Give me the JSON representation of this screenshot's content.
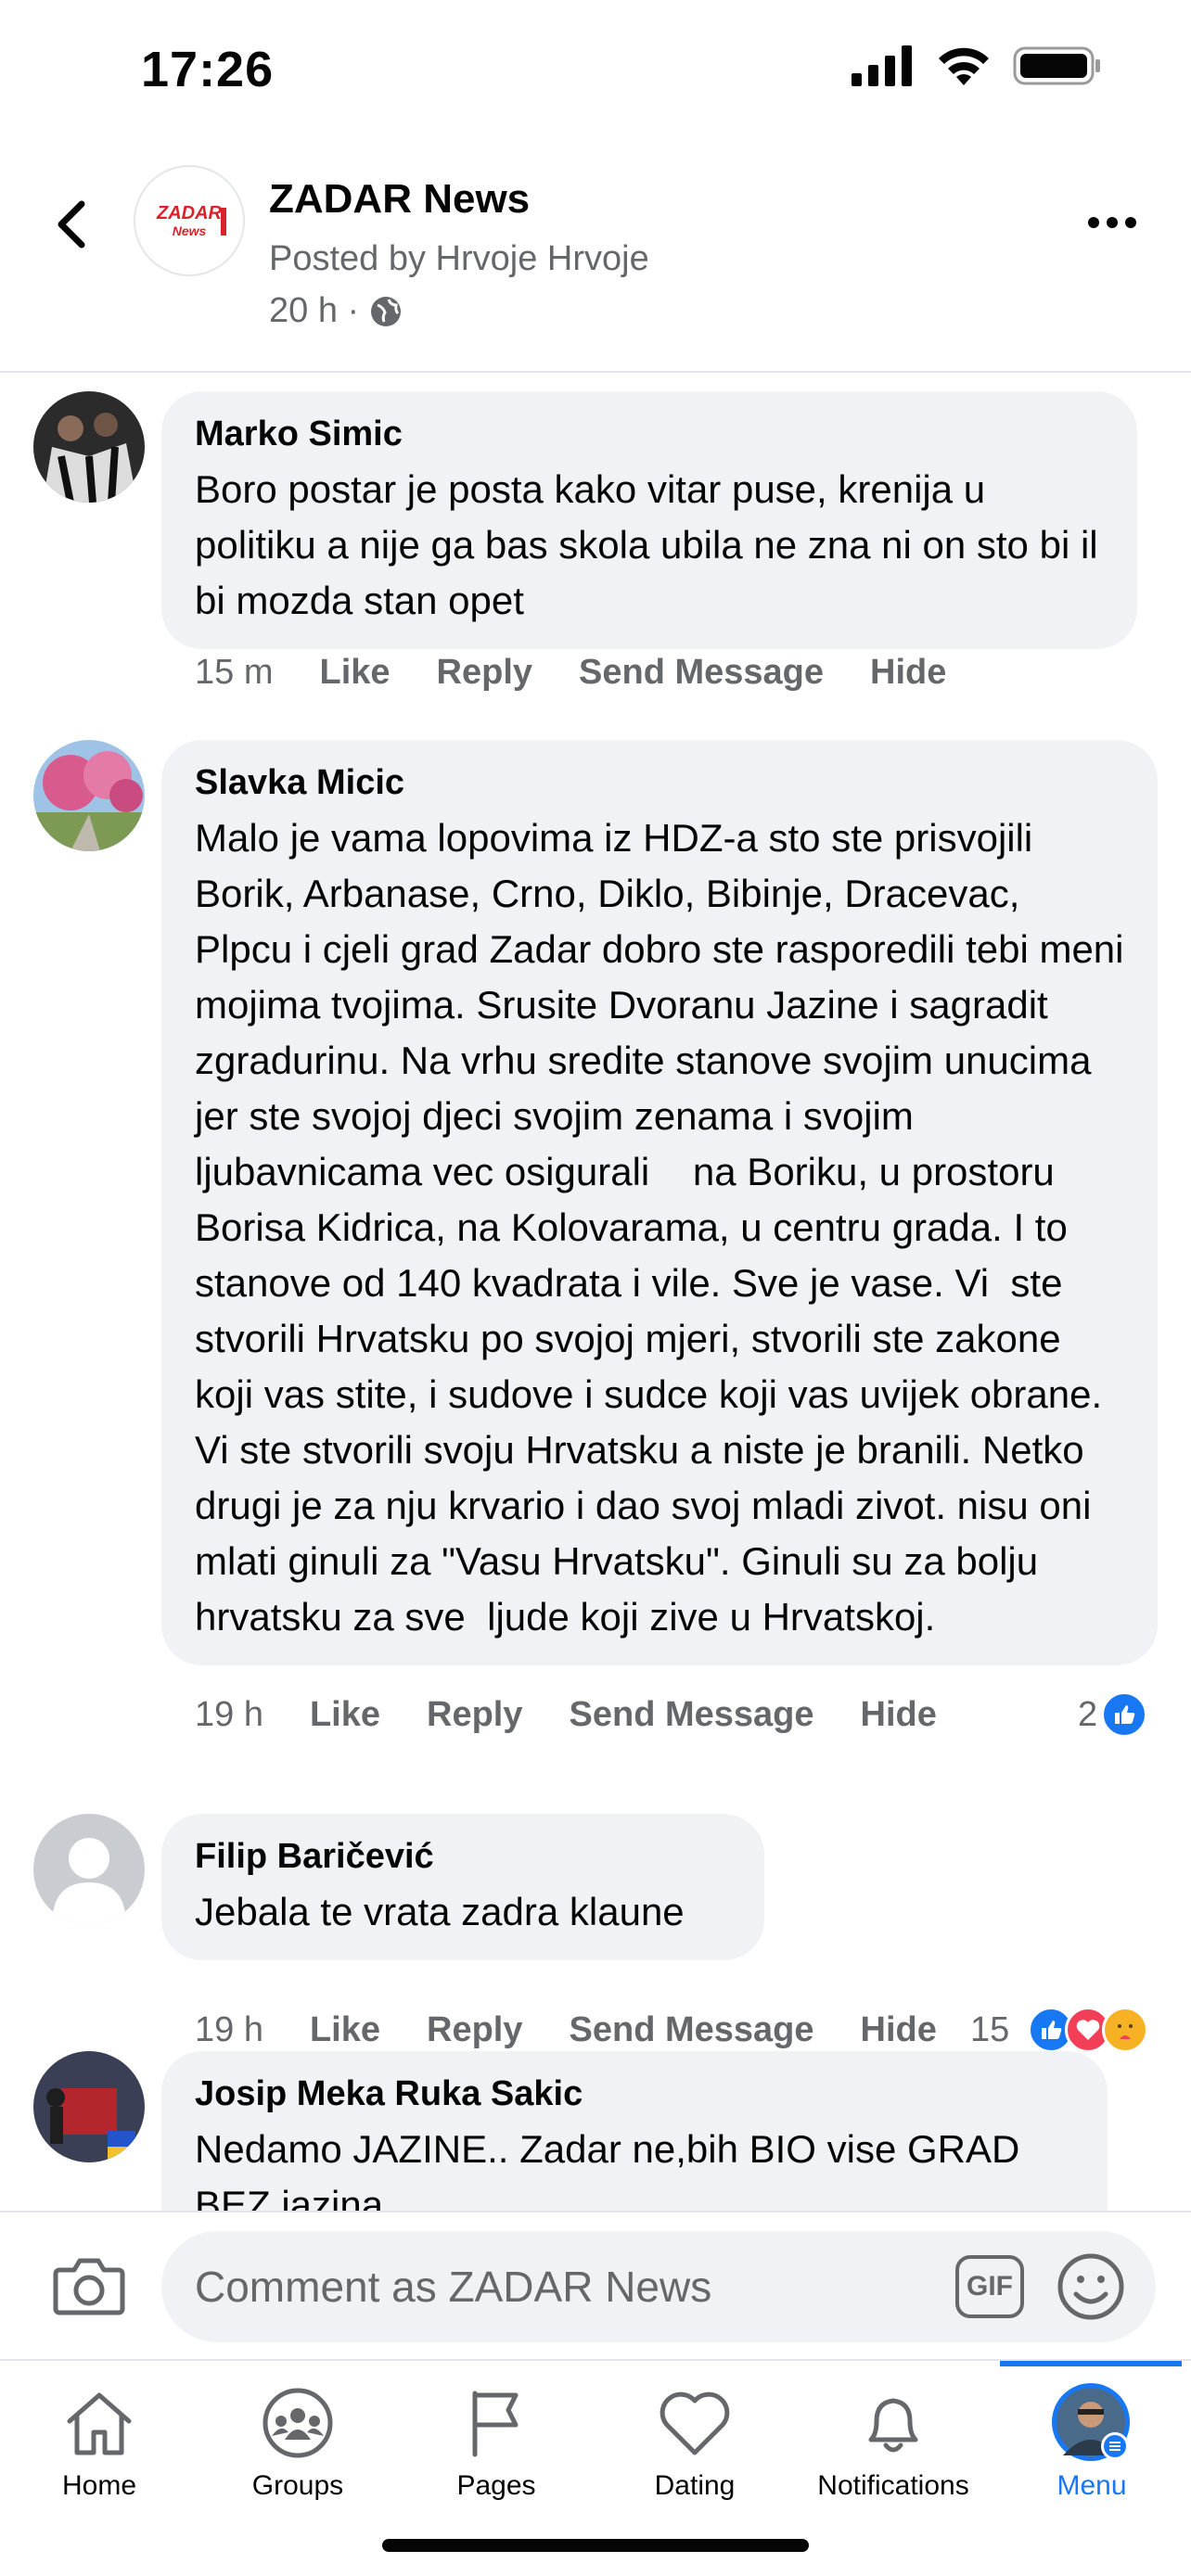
{
  "status_bar": {
    "time": "17:26"
  },
  "header": {
    "page_name": "ZADAR News",
    "posted_by": "Posted by Hrvoje Hrvoje",
    "time": "20 h ·",
    "logo_text_top": "ZADAR",
    "logo_text_bottom": "News"
  },
  "comments": [
    {
      "author": "Marko Simic",
      "text": "Boro postar je posta kako vitar puse, krenija u politiku a nije ga bas skola ubila ne zna ni on sto bi il bi mozda stan opet",
      "time": "15 m",
      "like": "Like",
      "reply": "Reply",
      "send": "Send Message",
      "hide": "Hide"
    },
    {
      "author": "Slavka Micic",
      "text": "Malo je vama lopovima iz HDZ-a sto ste prisvojili Borik, Arbanase, Crno, Diklo, Bibinje, Dracevac, Plpcu i cjeli grad Zadar dobro ste rasporedili tebi meni mojima tvojima. Srusite Dvoranu Jazine i sagradit zgradurinu. Na vrhu sredite stanove svojim unucima jer ste svojoj djeci svojim zenama i svojim ljubavnicama vec osigurali    na Boriku, u prostoru Borisa Kidrica, na Kolovarama, u centru grada. I to stanove od 140 kvadrata i vile. Sve je vase. Vi  ste stvorili Hrvatsku po svojoj mjeri, stvorili ste zakone koji vas stite, i sudove i sudce koji vas uvijek obrane. Vi ste stvorili svoju Hrvatsku a niste je branili. Netko drugi je za nju krvario i dao svoj mladi zivot. nisu oni mlati ginuli za \"Vasu Hrvatsku\". Ginuli su za bolju hrvatsku za sve  ljude koji zive u Hrvatskoj.",
      "time": "19 h",
      "like": "Like",
      "reply": "Reply",
      "send": "Send Message",
      "hide": "Hide",
      "reaction_count": "2"
    },
    {
      "author": "Filip Baričević",
      "text": "Jebala te vrata zadra klaune",
      "time": "19 h",
      "like": "Like",
      "reply": "Reply",
      "send": "Send Message",
      "hide": "Hide",
      "reaction_count": "15"
    },
    {
      "author": "Josip Meka Ruka Sakic",
      "text": "Nedamo JAZINE.. Zadar ne,bih BIO vise GRAD BEZ jazina"
    }
  ],
  "composer": {
    "placeholder": "Comment as ZADAR News",
    "gif_label": "GIF"
  },
  "tabs": [
    {
      "label": "Home",
      "icon": "home-icon"
    },
    {
      "label": "Groups",
      "icon": "groups-icon"
    },
    {
      "label": "Pages",
      "icon": "flag-icon"
    },
    {
      "label": "Dating",
      "icon": "heart-icon"
    },
    {
      "label": "Notifications",
      "icon": "bell-icon"
    },
    {
      "label": "Menu",
      "icon": "profile-avatar-icon"
    }
  ],
  "colors": {
    "accent": "#1877f2",
    "bubble": "#f0f2f5",
    "secondary_text": "#65676b",
    "like_reaction": "#1877f2",
    "love_reaction": "#f33e58",
    "care_reaction": "#f7b125"
  }
}
